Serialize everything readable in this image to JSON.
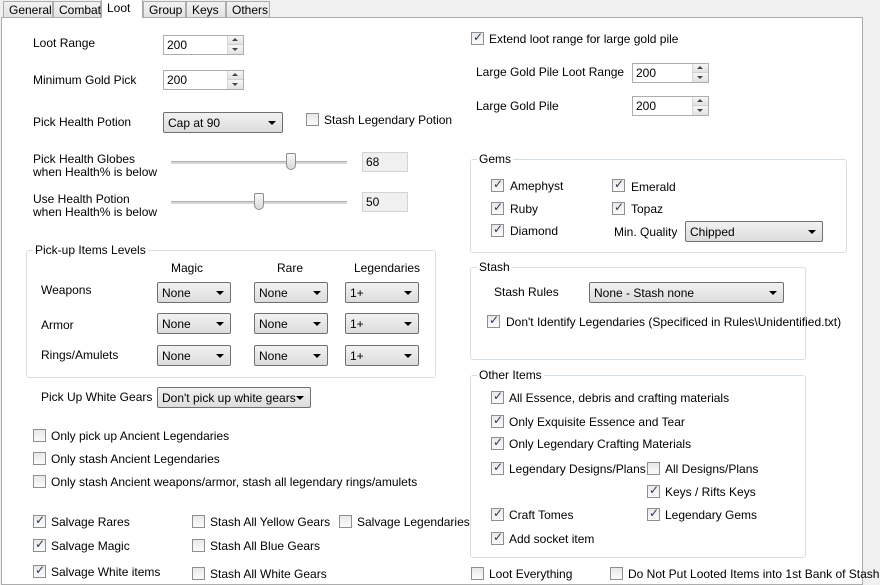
{
  "tabs": [
    "General",
    "Combat",
    "Loot",
    "Group",
    "Keys",
    "Others"
  ],
  "active_tab": "Loot",
  "loot_range": {
    "label": "Loot Range",
    "value": "200"
  },
  "min_gold": {
    "label": "Minimum Gold Pick",
    "value": "200"
  },
  "pick_health_potion": {
    "label": "Pick Health Potion",
    "value": "Cap at 90"
  },
  "stash_legendary_potion": {
    "label": "Stash Legendary Potion",
    "checked": false
  },
  "health_globes": {
    "label1": "Pick Health Globes",
    "label2": "when Health% is below",
    "value": "68",
    "level_pct": 68
  },
  "use_health_potion": {
    "label1": "Use Health Potion",
    "label2": "when Health% is below",
    "value": "50",
    "level_pct": 50
  },
  "pickup_levels": {
    "title": "Pick-up Items Levels",
    "headers": [
      "Magic",
      "Rare",
      "Legendaries"
    ],
    "rows": [
      {
        "label": "Weapons",
        "values": [
          "None",
          "None",
          "1+"
        ]
      },
      {
        "label": "Armor",
        "values": [
          "None",
          "None",
          "1+"
        ]
      },
      {
        "label": "Rings/Amulets",
        "values": [
          "None",
          "None",
          "1+"
        ]
      }
    ]
  },
  "white_gears": {
    "label": "Pick Up White Gears",
    "value": "Don't pick up white gears"
  },
  "ancient_options": [
    {
      "label": "Only pick up Ancient Legendaries",
      "checked": false
    },
    {
      "label": "Only stash Ancient Legendaries",
      "checked": false
    },
    {
      "label": "Only stash Ancient weapons/armor, stash all legendary rings/amulets",
      "checked": false
    }
  ],
  "salvage": {
    "col1": [
      {
        "label": "Salvage Rares",
        "checked": true
      },
      {
        "label": "Salvage Magic",
        "checked": true
      },
      {
        "label": "Salvage White items",
        "checked": true
      }
    ],
    "col2": [
      {
        "label": "Stash All Yellow Gears",
        "checked": false
      },
      {
        "label": "Stash All Blue Gears",
        "checked": false
      },
      {
        "label": "Stash All White Gears",
        "checked": false
      }
    ],
    "col3": [
      {
        "label": "Salvage Legendaries",
        "checked": false
      }
    ]
  },
  "extend_loot": {
    "label": "Extend loot range for large gold pile",
    "checked": true
  },
  "large_gold_range": {
    "label": "Large Gold Pile Loot Range",
    "value": "200"
  },
  "large_gold_pile": {
    "label": "Large Gold Pile",
    "value": "200"
  },
  "gems": {
    "title": "Gems",
    "items": [
      {
        "label": "Amephyst",
        "checked": true
      },
      {
        "label": "Emerald",
        "checked": true
      },
      {
        "label": "Ruby",
        "checked": true
      },
      {
        "label": "Topaz",
        "checked": true
      },
      {
        "label": "Diamond",
        "checked": true
      }
    ],
    "min_quality_label": "Min. Quality",
    "min_quality_value": "Chipped"
  },
  "stash": {
    "title": "Stash",
    "rules_label": "Stash Rules",
    "rules_value": "None - Stash none",
    "dont_identify": {
      "label": "Don't Identify Legendaries (Specificed in Rules\\Unidentified.txt)",
      "checked": true
    }
  },
  "other_items": {
    "title": "Other Items",
    "items": [
      {
        "label": "All Essence, debris and crafting materials",
        "checked": true
      },
      {
        "label": "Only Exquisite Essence and Tear",
        "checked": true
      },
      {
        "label": "Only Legendary Crafting Materials",
        "checked": true
      },
      {
        "label": "Legendary Designs/Plans",
        "checked": true
      },
      {
        "label": "All Designs/Plans",
        "checked": false
      },
      {
        "label": "Keys / Rifts Keys",
        "checked": true
      },
      {
        "label": "Craft Tomes",
        "checked": true
      },
      {
        "label": "Legendary Gems",
        "checked": true
      },
      {
        "label": "Add socket item",
        "checked": true
      }
    ]
  },
  "loot_everything": {
    "label": "Loot Everything",
    "checked": false
  },
  "do_not_put": {
    "label": "Do Not Put Looted Items into 1st Bank of Stash",
    "checked": false
  }
}
